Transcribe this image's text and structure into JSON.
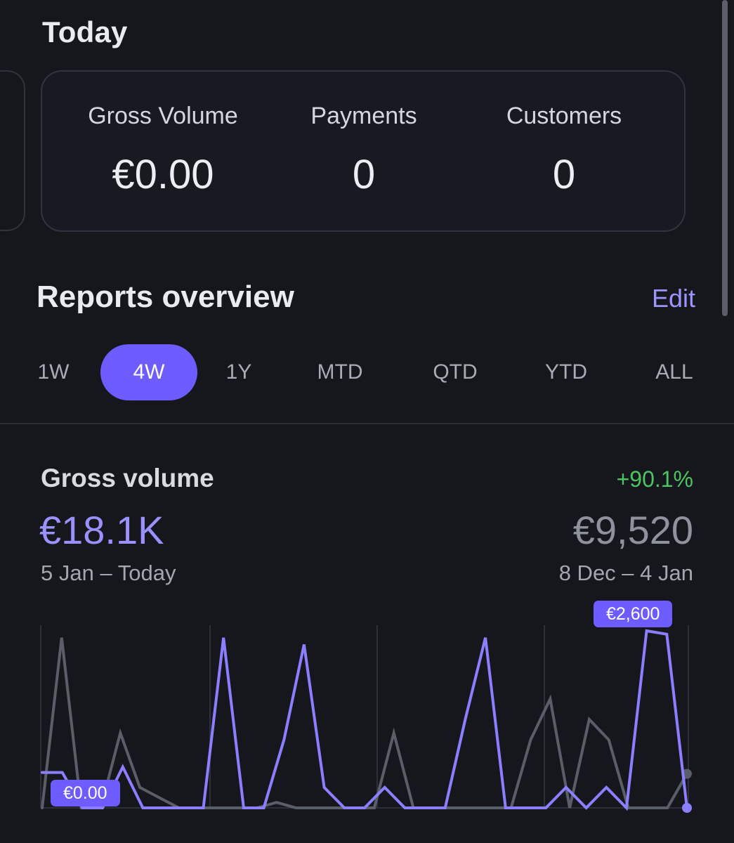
{
  "today": {
    "title": "Today",
    "stats": [
      {
        "label": "Gross Volume",
        "value": "€0.00"
      },
      {
        "label": "Payments",
        "value": "0"
      },
      {
        "label": "Customers",
        "value": "0"
      }
    ]
  },
  "reports": {
    "title": "Reports overview",
    "edit_label": "Edit",
    "ranges": [
      "1W",
      "4W",
      "1Y",
      "MTD",
      "QTD",
      "YTD",
      "ALL"
    ],
    "selected_range": "4W"
  },
  "gross_volume": {
    "title": "Gross volume",
    "change": "+90.1%",
    "current_value": "€18.1K",
    "previous_value": "€9,520",
    "current_range": "5 Jan – Today",
    "previous_range": "8 Dec – 4 Jan",
    "min_label": "€0.00",
    "max_label": "€2,600"
  },
  "colors": {
    "accent": "#6d5cff",
    "current_series": "#8b7fff",
    "previous_series": "#5a5e68",
    "positive": "#4bc461",
    "background": "#15171d"
  },
  "chart_data": {
    "type": "line",
    "ylim": [
      0,
      2600
    ],
    "grid": true,
    "series": [
      {
        "values": [
          520,
          520,
          0,
          0,
          600,
          0,
          0,
          0,
          0,
          2500,
          0,
          0,
          1000,
          2400,
          300,
          0,
          0,
          300,
          0,
          0,
          0,
          1300,
          2500,
          0,
          0,
          0,
          300,
          0,
          300,
          0,
          2600,
          2550,
          0
        ]
      },
      {
        "values": [
          0,
          2500,
          0,
          0,
          1100,
          300,
          150,
          0,
          0,
          0,
          0,
          0,
          80,
          0,
          0,
          0,
          0,
          0,
          1100,
          0,
          0,
          0,
          0,
          0,
          0,
          1000,
          1600,
          0,
          1300,
          1000,
          0,
          0,
          0,
          500
        ]
      }
    ]
  }
}
